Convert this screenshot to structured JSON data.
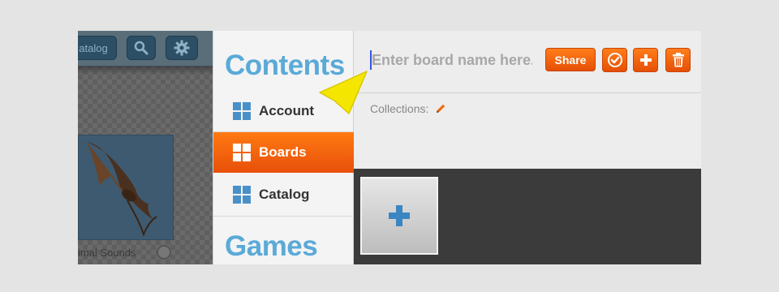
{
  "left_panel": {
    "catalog_button_label": "atalog",
    "caption": "imal Sounds",
    "icons": [
      "search-icon",
      "gear-icon",
      "bat-image"
    ]
  },
  "menu": {
    "sections": [
      {
        "heading": "Contents"
      },
      {
        "heading": "Games"
      }
    ],
    "items": [
      {
        "label": "Account",
        "icon": "grid-icon",
        "selected": false
      },
      {
        "label": "Boards",
        "icon": "grid-icon",
        "selected": true
      },
      {
        "label": "Catalog",
        "icon": "grid-icon",
        "selected": false
      }
    ]
  },
  "editor": {
    "board_name_value": "",
    "board_name_placeholder": "Enter board name here..",
    "share_label": "Share",
    "actions": [
      "check-icon",
      "plus-icon",
      "trash-icon"
    ],
    "collections_label": "Collections:",
    "collections_icon": "pencil-icon"
  },
  "board_area": {
    "add_tile_icon": "plus-icon"
  },
  "colors": {
    "accent_orange": "#f26a0e",
    "heading_blue": "#5aaad8",
    "icon_blue": "#4a90c8",
    "board_bg": "#3b3b3b",
    "pointer_yellow": "#f5e600"
  }
}
